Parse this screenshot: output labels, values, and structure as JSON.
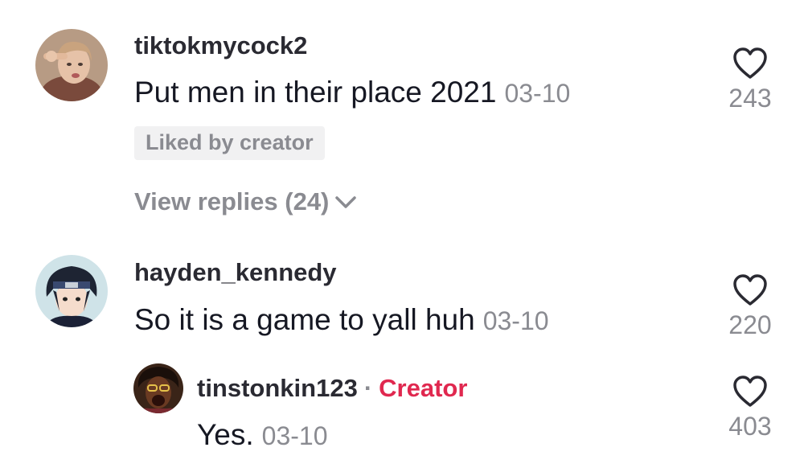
{
  "comments": [
    {
      "username": "tiktokmycock2",
      "text": "Put men in their place 2021",
      "date": "03-10",
      "likes": "243",
      "badge": "Liked by creator",
      "view_replies": "View replies (24)"
    },
    {
      "username": "hayden_kennedy",
      "text": "So it is a game to yall huh",
      "date": "03-10",
      "likes": "220",
      "reply": {
        "username": "tinstonkin123",
        "separator": "·",
        "creator_label": "Creator",
        "text": "Yes.",
        "date": "03-10",
        "likes": "403"
      }
    }
  ],
  "colors": {
    "primary_text": "#161823",
    "secondary_text": "#8a8b91",
    "creator_accent": "#e0284f",
    "badge_bg": "#f1f1f2"
  },
  "icons": [
    "heart-outline-icon",
    "chevron-down-icon"
  ]
}
